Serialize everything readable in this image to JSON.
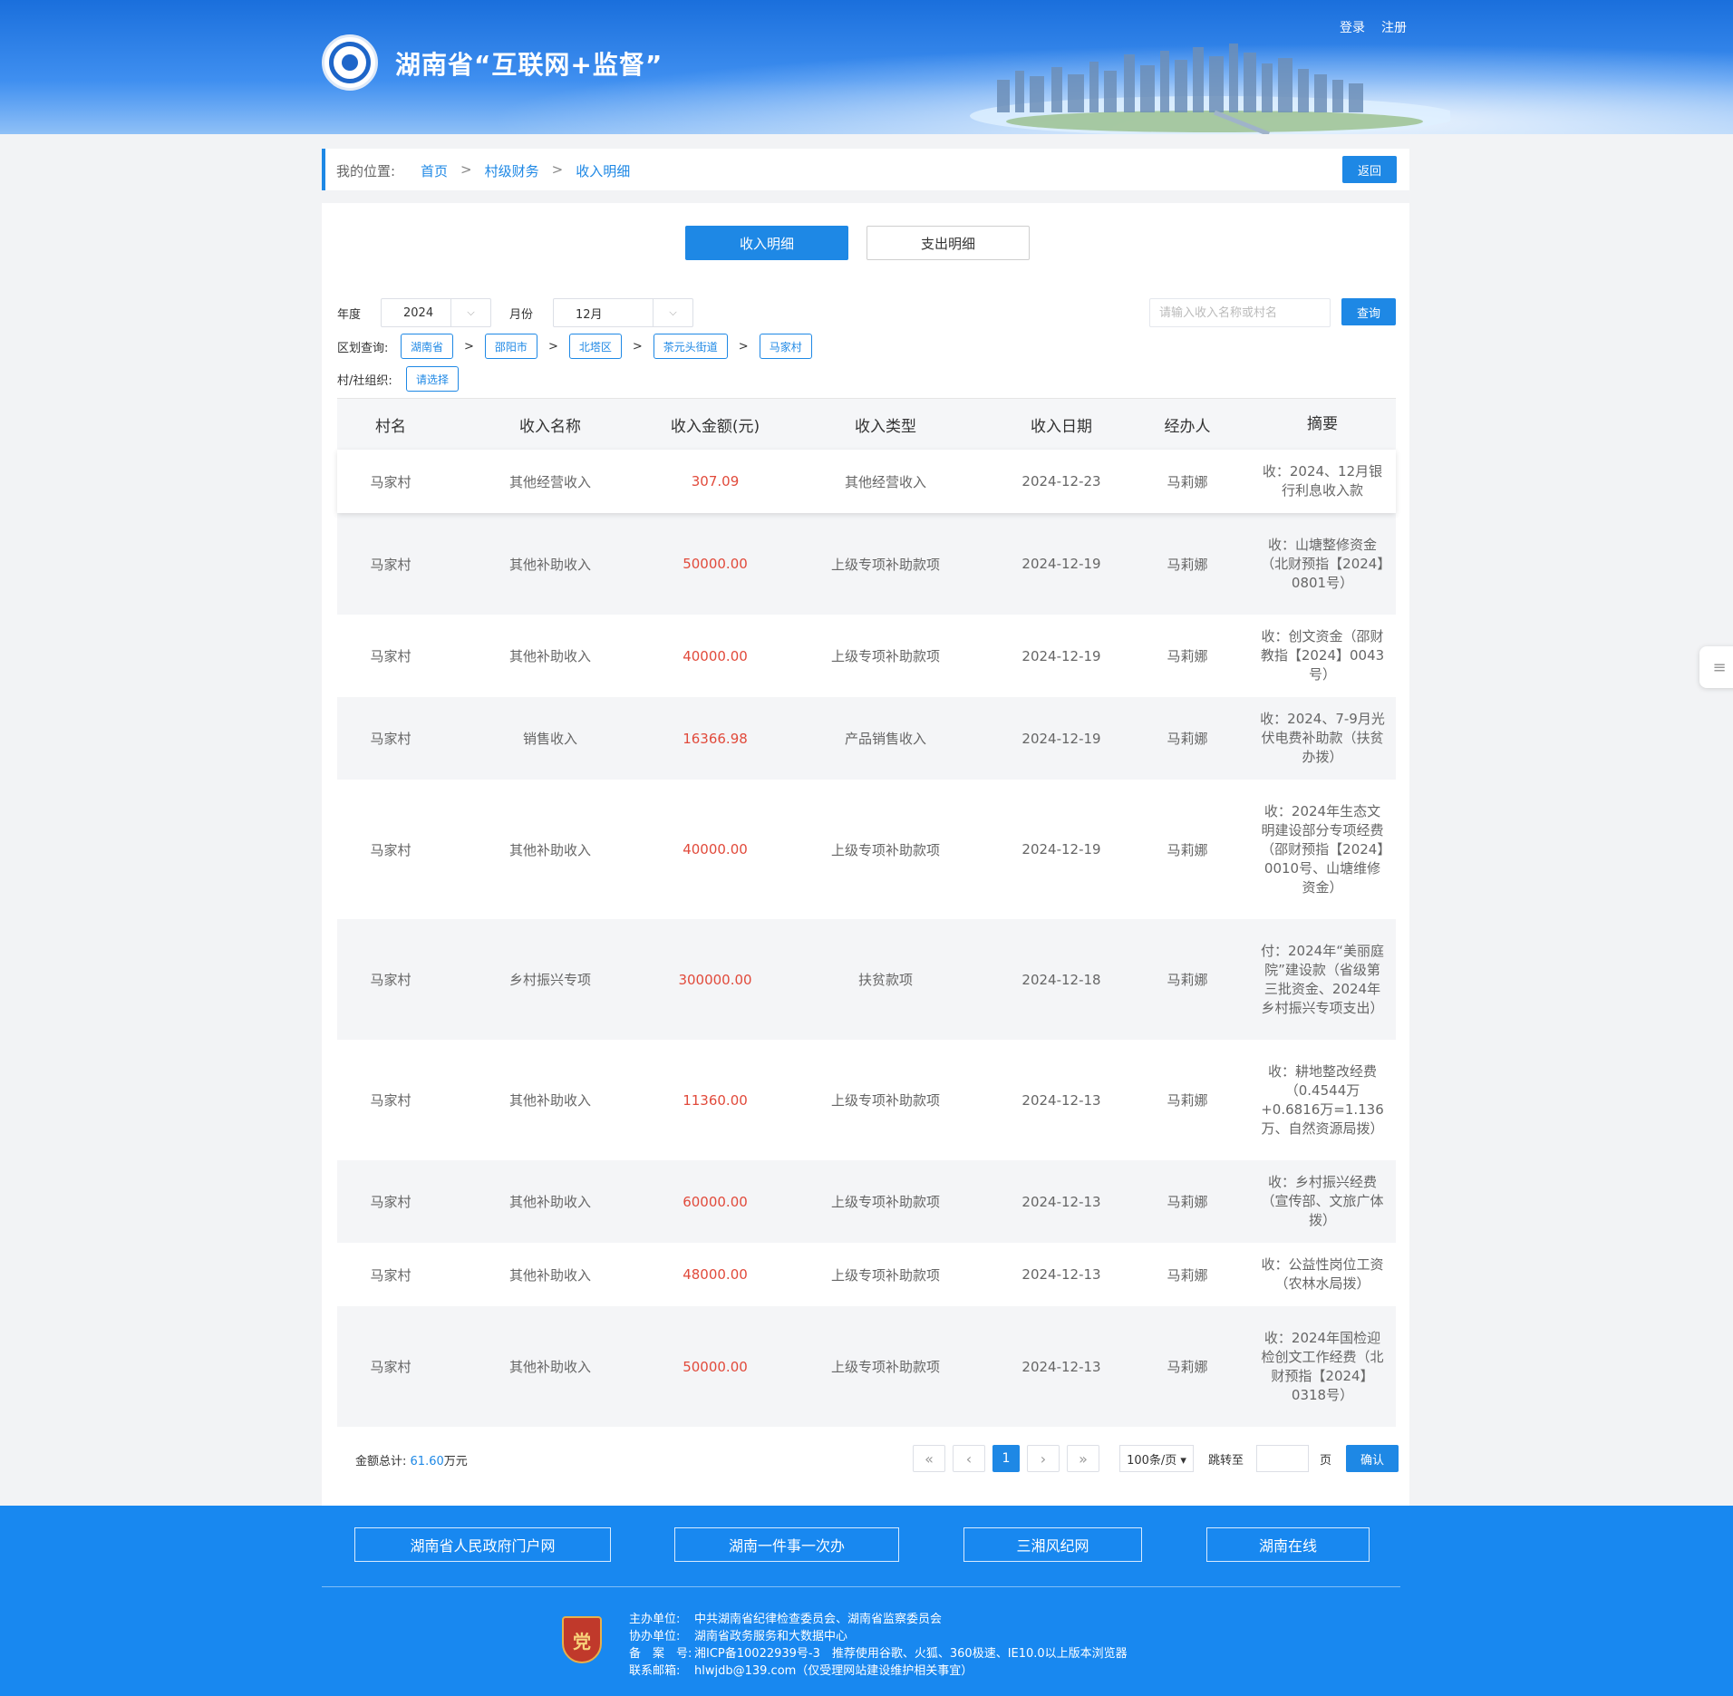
{
  "header": {
    "site_title": "湖南省“互联网+监督”",
    "login": "登录",
    "register": "注册"
  },
  "breadcrumb": {
    "label": "我的位置:",
    "items": [
      "首页",
      "村级财务",
      "收入明细"
    ],
    "separator": ">",
    "back_label": "返回"
  },
  "tabs": {
    "income": "收入明细",
    "expense": "支出明细"
  },
  "filters": {
    "year_label": "年度",
    "year_value": "2024",
    "month_label": "月份",
    "month_value": "12月",
    "search_placeholder": "请输入收入名称或村名",
    "query_label": "查询",
    "region_label": "区划查询:",
    "regions": [
      "湖南省",
      "邵阳市",
      "北塔区",
      "茶元头街道",
      "马家村"
    ],
    "region_sep": ">",
    "org_label": "村/社组织:",
    "org_value": "请选择"
  },
  "table": {
    "headers": [
      "村名",
      "收入名称",
      "收入金额(元)",
      "收入类型",
      "收入日期",
      "经办人",
      "摘要"
    ],
    "rows": [
      {
        "village": "马家村",
        "name": "其他经营收入",
        "amount": "307.09",
        "type": "其他经营收入",
        "date": "2024-12-23",
        "handler": "马莉娜",
        "summary": "收：2024、12月银行利息收入款"
      },
      {
        "village": "马家村",
        "name": "其他补助收入",
        "amount": "50000.00",
        "type": "上级专项补助款项",
        "date": "2024-12-19",
        "handler": "马莉娜",
        "summary": "收：山塘整修资金（北财预指【2024】0801号）"
      },
      {
        "village": "马家村",
        "name": "其他补助收入",
        "amount": "40000.00",
        "type": "上级专项补助款项",
        "date": "2024-12-19",
        "handler": "马莉娜",
        "summary": "收：创文资金（邵财教指【2024】0043号）"
      },
      {
        "village": "马家村",
        "name": "销售收入",
        "amount": "16366.98",
        "type": "产品销售收入",
        "date": "2024-12-19",
        "handler": "马莉娜",
        "summary": "收：2024、7-9月光伏电费补助款（扶贫办拨）"
      },
      {
        "village": "马家村",
        "name": "其他补助收入",
        "amount": "40000.00",
        "type": "上级专项补助款项",
        "date": "2024-12-19",
        "handler": "马莉娜",
        "summary": "收：2024年生态文明建设部分专项经费（邵财预指【2024】0010号、山塘维修资金）"
      },
      {
        "village": "马家村",
        "name": "乡村振兴专项",
        "amount": "300000.00",
        "type": "扶贫款项",
        "date": "2024-12-18",
        "handler": "马莉娜",
        "summary": "付：2024年“美丽庭院”建设款（省级第三批资金、2024年乡村振兴专项支出）"
      },
      {
        "village": "马家村",
        "name": "其他补助收入",
        "amount": "11360.00",
        "type": "上级专项补助款项",
        "date": "2024-12-13",
        "handler": "马莉娜",
        "summary": "收：耕地整改经费（0.4544万+0.6816万=1.136万、自然资源局拨）"
      },
      {
        "village": "马家村",
        "name": "其他补助收入",
        "amount": "60000.00",
        "type": "上级专项补助款项",
        "date": "2024-12-13",
        "handler": "马莉娜",
        "summary": "收：乡村振兴经费（宣传部、文旅广体拨）"
      },
      {
        "village": "马家村",
        "name": "其他补助收入",
        "amount": "48000.00",
        "type": "上级专项补助款项",
        "date": "2024-12-13",
        "handler": "马莉娜",
        "summary": "收：公益性岗位工资（农林水局拨）"
      },
      {
        "village": "马家村",
        "name": "其他补助收入",
        "amount": "50000.00",
        "type": "上级专项补助款项",
        "date": "2024-12-13",
        "handler": "马莉娜",
        "summary": "收：2024年国检迎检创文工作经费（北财预指【2024】0318号）"
      }
    ]
  },
  "totals": {
    "label": "金额总计:",
    "value": "61.60",
    "unit": "万元"
  },
  "pagination": {
    "first": "«",
    "prev": "‹",
    "current": "1",
    "next": "›",
    "last": "»",
    "page_size": "100条/页 ▾",
    "jump_label": "跳转至",
    "page_unit": "页",
    "confirm": "确认"
  },
  "side_float": {
    "icon": "≡"
  },
  "footer": {
    "links": [
      "湖南省人民政府门户网",
      "湖南一件事一次办",
      "三湘风纪网",
      "湖南在线"
    ],
    "emblem": "党",
    "info": [
      {
        "key": "主办单位:",
        "value": "中共湖南省纪律检查委员会、湖南省监察委员会"
      },
      {
        "key": "协办单位:",
        "value": "湖南省政务服务和大数据中心"
      },
      {
        "key": "备　案　号:",
        "value": "湘ICP备10022939号-3　推荐使用谷歌、火狐、360极速、IE10.0以上版本浏览器"
      },
      {
        "key": "联系邮箱:",
        "value": "hlwjdb@139.com（仅受理网站建设维护相关事宜）"
      }
    ]
  },
  "colors": {
    "primary": "#1e88e5",
    "amount": "#e14a3b",
    "footer_bg": "#1888f0"
  }
}
